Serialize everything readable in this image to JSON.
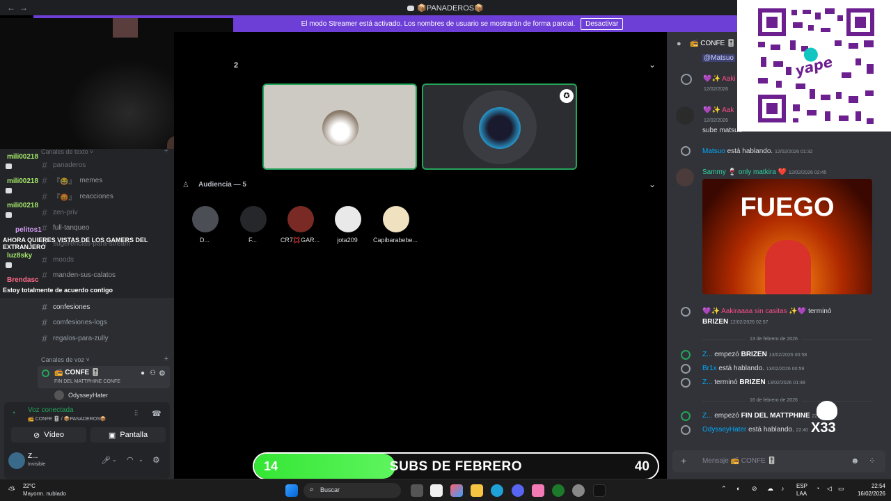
{
  "window": {
    "title": "📦PANADEROS📦",
    "nav_back": "←",
    "nav_forward": "→"
  },
  "banner": {
    "text": "El modo Streamer está activado. Los nombres de usuario se mostrarán de forma parcial.",
    "button": "Desactivar"
  },
  "sidebar": {
    "text_category": "Canales de texto",
    "voice_category": "Canales de voz",
    "channels": [
      {
        "name": "panaderos"
      },
      {
        "name": "memes",
        "prefix": "『😂』"
      },
      {
        "name": "reacciones",
        "prefix": "『😡』"
      },
      {
        "name": "zen-priv"
      },
      {
        "name": "full-tanqueo"
      },
      {
        "name": "sugerencias-para-stream"
      },
      {
        "name": "moods"
      },
      {
        "name": "manden-sus-calatos"
      },
      {
        "name": "confesiones"
      },
      {
        "name": "comfesiones-logs"
      },
      {
        "name": "regalos-para-zully"
      }
    ],
    "voice_channel": {
      "name": "📻 CONFE 🎚️",
      "status": "FIN DEL MATTPHINE CONFE",
      "member": "OdysseyHater"
    }
  },
  "chat_overlay": [
    {
      "user": "mili00218",
      "color": "#a3e66b"
    },
    {
      "user": "mili00218",
      "color": "#a3e66b"
    },
    {
      "user": "mili00218",
      "color": "#a3e66b"
    },
    {
      "user": "pelitos1",
      "color": "#d59cf5"
    },
    {
      "message": "AHORA QUIERES VISTAS DE LOS GAMERS DEL EXTRANJERO"
    },
    {
      "user": "luz8sky",
      "color": "#a3e66b"
    },
    {
      "user": "Brendasc",
      "color": "#ff6b8a"
    },
    {
      "message": "Estoy totalmente de acuerdo contigo"
    }
  ],
  "voice_panel": {
    "status": "Voz conectada",
    "location": "📻 CONFE 🎚️ / 📦PANADEROS📦",
    "video_button": "Vídeo",
    "screen_button": "Pantalla"
  },
  "user_panel": {
    "name": "Z...",
    "status": "Invisible"
  },
  "stage": {
    "speakers_count": "2",
    "audience_label": "Audiencia — 5",
    "audience": [
      {
        "name": "D...",
        "color": "#555"
      },
      {
        "name": "F...",
        "color": "#333"
      },
      {
        "name": "CR7💢GAR...",
        "color": "#a33"
      },
      {
        "name": "jota209",
        "color": "#e9e9e9"
      },
      {
        "name": "Capibarabebe...",
        "color": "#f0e2c0"
      }
    ]
  },
  "chat": {
    "channel": "📻 CONFE 🎚️",
    "mention": "@Matsuo",
    "messages": [
      {
        "user": "💜✨ Aaki",
        "time": "12/02/2026"
      },
      {
        "user": "💜✨ Aak",
        "time": "12/02/2026",
        "text": "sube matsuo"
      },
      {
        "user": "Matsuo",
        "text": "está hablando.",
        "time": "12/02/2026 01:32"
      },
      {
        "user": "Sammy 🍷 only matkira ❤️",
        "time": "12/02/2026 02:45"
      },
      {
        "gif_text": "FUEGO"
      },
      {
        "user": "💜✨ Aakiraaaa sin casitas ✨💜",
        "text": "terminó",
        "bold": "BRIZEN",
        "time": "12/02/2026 02:57"
      }
    ],
    "date1": "13 de febrero de 2026",
    "messages2": [
      {
        "user": "Z...",
        "text": "empezó",
        "bold": "BRIZEN",
        "time": "13/02/2026 00:58"
      },
      {
        "user": "Br1x",
        "text": "está hablando.",
        "time": "13/02/2026 00:59"
      },
      {
        "user": "Z...",
        "text": "terminó",
        "bold": "BRIZEN",
        "time": "13/02/2026 01:48"
      }
    ],
    "date2": "16 de febrero de 2026",
    "messages3": [
      {
        "user": "Z...",
        "text": "empezó",
        "bold": "FIN DEL MATTPHINE",
        "time": "22:40"
      },
      {
        "user": "OdysseyHater",
        "text": "está hablando.",
        "time": "22:40"
      }
    ],
    "input_placeholder": "Mensaje 📻 CONFE 🎚️"
  },
  "qr": {
    "brand": "yape"
  },
  "subs": {
    "current": "14",
    "goal": "40",
    "label": "SUBS DE FEBRERO",
    "progress": 0.35
  },
  "taskbar": {
    "weather_temp": "22°C",
    "weather_desc": "Mayorm. nublado",
    "search": "Buscar",
    "lang": "ESP",
    "lang2": "LAA",
    "time": "22:54",
    "date": "16/02/2026"
  },
  "watermark": "X33"
}
